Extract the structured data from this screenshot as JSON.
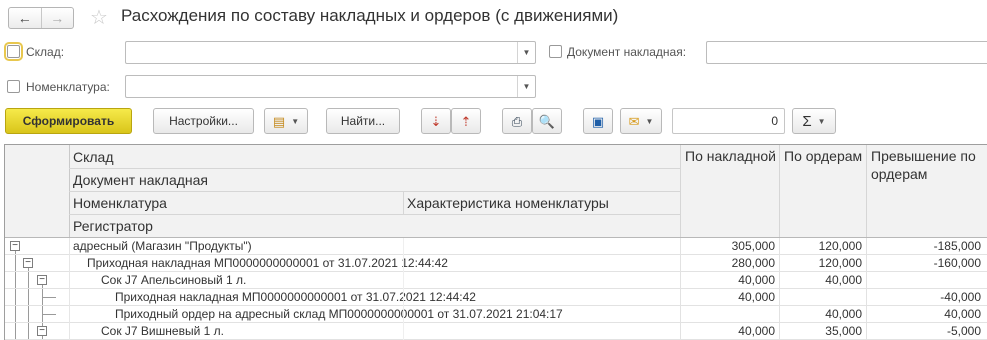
{
  "window": {
    "title": "Расхождения по составу накладных и ордеров (с движениями)",
    "back_icon": "arrow-left-icon",
    "forward_icon": "arrow-right-icon",
    "favorite_icon": "star-icon"
  },
  "filters": {
    "warehouse": {
      "label": "Склад:",
      "value": ""
    },
    "nomenclature": {
      "label": "Номенклатура:",
      "value": ""
    },
    "invoice_document": {
      "label": "Документ накладная:",
      "value": ""
    }
  },
  "toolbar": {
    "generate": "Сформировать",
    "settings": "Настройки...",
    "find": "Найти...",
    "sum_value": "0",
    "sum_icon": "sigma-icon"
  },
  "report": {
    "group_headers": [
      "Склад",
      "Документ накладная",
      "Номенклатура",
      "Регистратор"
    ],
    "characteristic_header": "Характеристика номенклатуры",
    "col_invoice": "По накладной",
    "col_orders": "По ордерам",
    "col_excess": "Превышение по ордерам",
    "rows": [
      {
        "level": 0,
        "text": "адресный (Магазин \"Продукты\")",
        "invoice": "305,000",
        "orders": "120,000",
        "excess": "-185,000"
      },
      {
        "level": 1,
        "text": "Приходная накладная МП0000000000001 от 31.07.2021 12:44:42",
        "invoice": "280,000",
        "orders": "120,000",
        "excess": "-160,000"
      },
      {
        "level": 2,
        "text": "Сок J7 Апельсиновый 1 л.",
        "invoice": "40,000",
        "orders": "40,000",
        "excess": ""
      },
      {
        "level": 3,
        "text": "Приходная накладная МП0000000000001 от 31.07.2021 12:44:42",
        "invoice": "40,000",
        "orders": "",
        "excess": "-40,000"
      },
      {
        "level": 3,
        "text": "Приходный ордер на адресный склад МП0000000000001 от 31.07.2021 21:04:17",
        "invoice": "",
        "orders": "40,000",
        "excess": "40,000"
      },
      {
        "level": 2,
        "text": "Сок J7 Вишневый 1 л.",
        "invoice": "40,000",
        "orders": "35,000",
        "excess": "-5,000"
      }
    ]
  }
}
